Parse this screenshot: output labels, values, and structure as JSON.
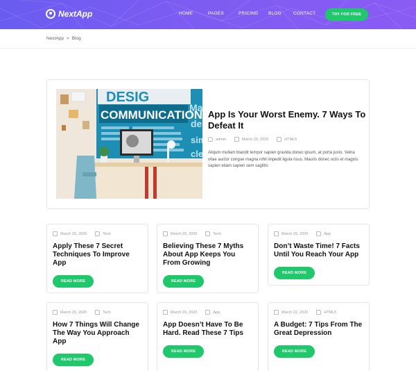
{
  "header": {
    "logo_text": "NextApp",
    "nav": [
      "HOME",
      "PAGES",
      "PRICING",
      "BLOG",
      "CONTACT"
    ],
    "cta": "TRY FOR FREE"
  },
  "breadcrumb": {
    "items": [
      "NextApp",
      "Blog"
    ],
    "separator": ">"
  },
  "featured": {
    "title": "App Is Your Worst Enemy. 7 Ways To Defeat It",
    "author": "admin",
    "date": "March 29, 2020",
    "category": "HTML5",
    "excerpt": "Aliqum mullam blandit tempor sapien gravida donec ipsum, at porta justo. Velna vitae auctor congue magna nihil impedit ligula risus. Mauris donec ociis et magnis sapien etiam sapien sem sagittis",
    "image_words": [
      "DESIG",
      "COMMUNICATION",
      "Ma",
      "de",
      "sim",
      "cle"
    ]
  },
  "cards": [
    {
      "date": "March 29, 2020",
      "category": "Tech",
      "title": "Apply These 7 Secret Techniques To Improve App",
      "button": "READ MORE"
    },
    {
      "date": "March 29, 2020",
      "category": "Tech",
      "title": "Believing These 7 Myths About App Keeps You From Growing",
      "button": "READ MORE"
    },
    {
      "date": "March 29, 2020",
      "category": "App",
      "title": "Don’t Waste Time! 7 Facts Until You Reach Your App",
      "button": "READ MORE"
    },
    {
      "date": "March 29, 2020",
      "category": "Tech",
      "title": "How 7 Things Will Change The Way You Approach App",
      "button": "READ MORE"
    },
    {
      "date": "March 29, 2020",
      "category": "App",
      "title": "App Doesn’t Have To Be Hard. Read These 7 Tips",
      "button": "READ MORE"
    },
    {
      "date": "March 22, 2020",
      "category": "HTML5",
      "title": "A Budget: 7 Tips From The Great Depression",
      "button": "READ MORE"
    }
  ],
  "colors": {
    "header_gradient_start": "#6a5cf0",
    "header_gradient_end": "#8a5cf4",
    "accent_green": "#1fc86a"
  }
}
